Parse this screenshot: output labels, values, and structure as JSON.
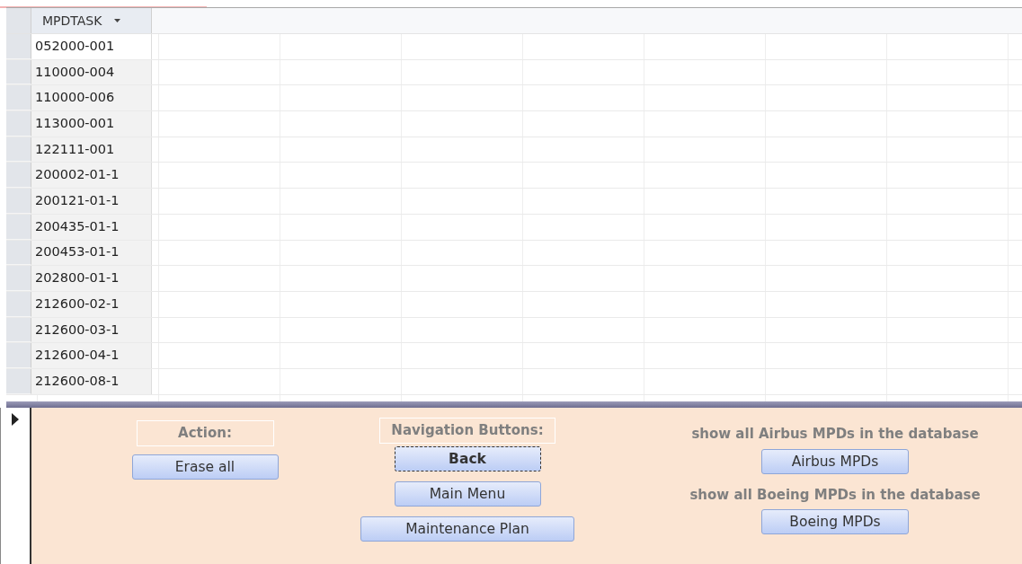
{
  "datasheet": {
    "columns": [
      {
        "label": "MPDTASK"
      }
    ],
    "rows": [
      {
        "cells": [
          "052000-001"
        ],
        "selected": true
      },
      {
        "cells": [
          "110000-004"
        ],
        "selected": false
      },
      {
        "cells": [
          "110000-006"
        ],
        "selected": false
      },
      {
        "cells": [
          "113000-001"
        ],
        "selected": false
      },
      {
        "cells": [
          "122111-001"
        ],
        "selected": false
      },
      {
        "cells": [
          "200002-01-1"
        ],
        "selected": false
      },
      {
        "cells": [
          "200121-01-1"
        ],
        "selected": false
      },
      {
        "cells": [
          "200435-01-1"
        ],
        "selected": false
      },
      {
        "cells": [
          "200453-01-1"
        ],
        "selected": false
      },
      {
        "cells": [
          "202800-01-1"
        ],
        "selected": false
      },
      {
        "cells": [
          "212600-02-1"
        ],
        "selected": false
      },
      {
        "cells": [
          "212600-03-1"
        ],
        "selected": false
      },
      {
        "cells": [
          "212600-04-1"
        ],
        "selected": false
      },
      {
        "cells": [
          "212600-08-1"
        ],
        "selected": false
      }
    ]
  },
  "form": {
    "sections": [
      {
        "kind": "labeled",
        "label": "Action:",
        "buttons": [
          {
            "label": "Erase all",
            "focused": false
          }
        ]
      },
      {
        "kind": "labeled",
        "label": "Navigation Buttons:",
        "buttons": [
          {
            "label": "Back",
            "focused": true
          },
          {
            "label": "Main Menu",
            "focused": false
          },
          {
            "label": "Maintenance Plan",
            "focused": false
          }
        ]
      },
      {
        "kind": "captioned",
        "items": [
          {
            "caption": "show all Airbus MPDs in the database",
            "button": {
              "label": "Airbus MPDs",
              "focused": false
            }
          },
          {
            "caption": "show all Boeing MPDs in the database",
            "button": {
              "label": "Boeing MPDs",
              "focused": false
            }
          }
        ]
      }
    ]
  }
}
